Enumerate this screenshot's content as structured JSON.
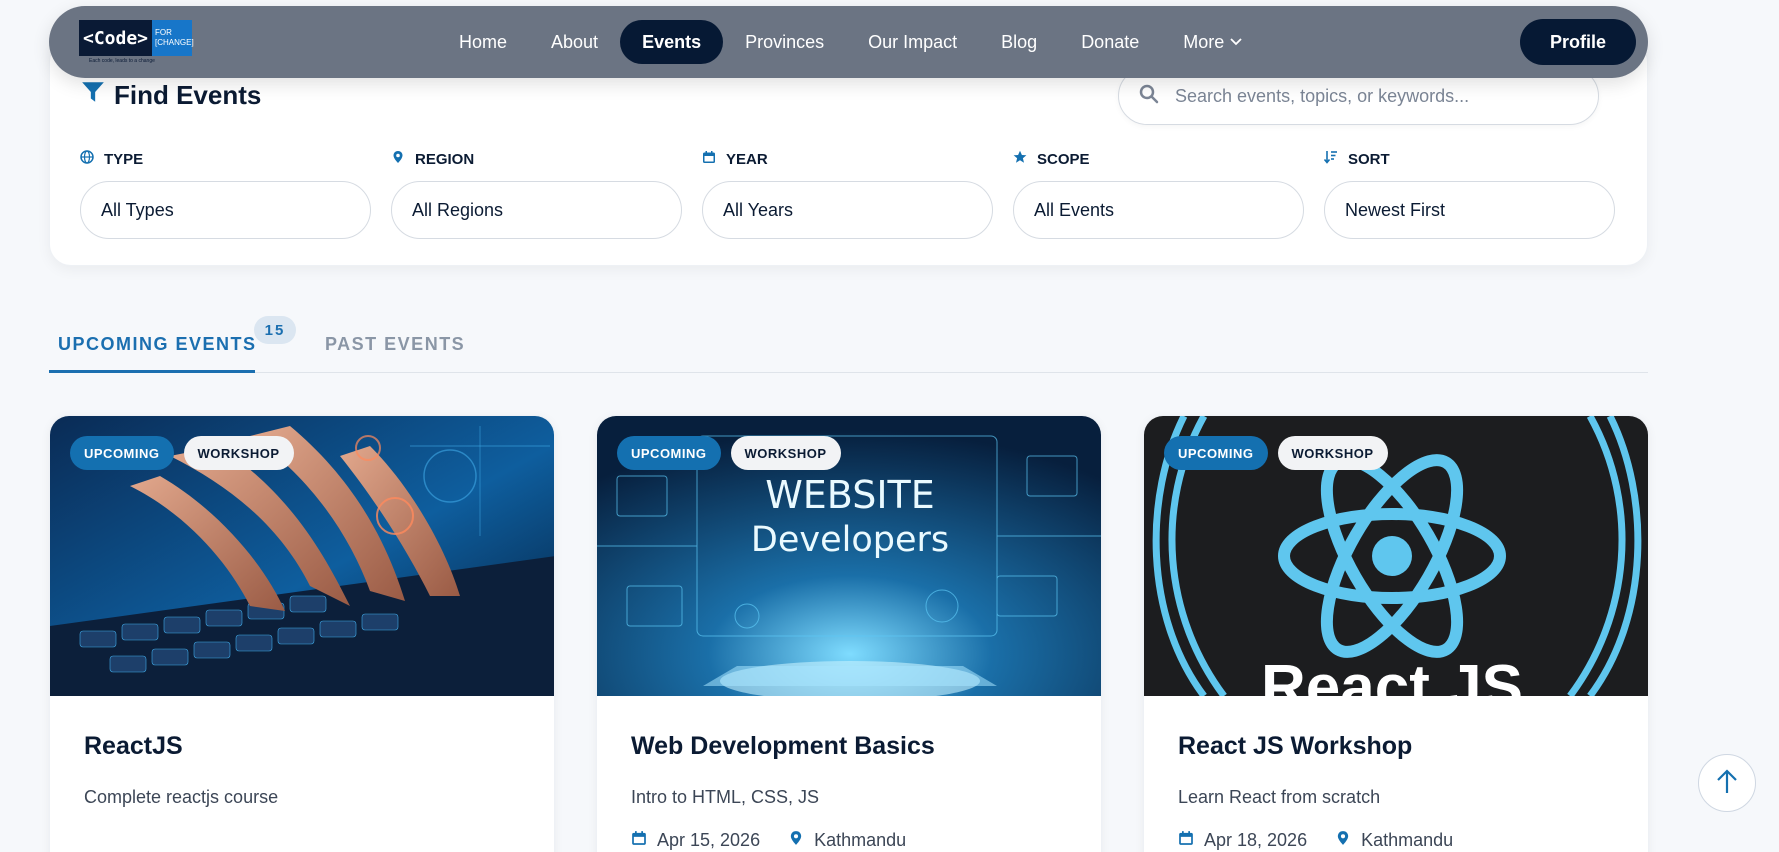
{
  "nav": {
    "logo": {
      "code": "<Code>",
      "for": "FOR",
      "change": "[CHANGE]",
      "tagline": "Each code, leads to a change"
    },
    "links": [
      {
        "label": "Home"
      },
      {
        "label": "About"
      },
      {
        "label": "Events",
        "active": true
      },
      {
        "label": "Provinces"
      },
      {
        "label": "Our Impact"
      },
      {
        "label": "Blog"
      },
      {
        "label": "Donate"
      },
      {
        "label": "More"
      }
    ],
    "profile_label": "Profile"
  },
  "filters": {
    "title": "Find Events",
    "search_placeholder": "Search events, topics, or keywords...",
    "items": [
      {
        "label": "TYPE",
        "value": "All Types",
        "icon": "globe-icon"
      },
      {
        "label": "REGION",
        "value": "All Regions",
        "icon": "map-pin-icon"
      },
      {
        "label": "YEAR",
        "value": "All Years",
        "icon": "calendar-icon"
      },
      {
        "label": "SCOPE",
        "value": "All Events",
        "icon": "star-icon"
      },
      {
        "label": "SORT",
        "value": "Newest First",
        "icon": "sort-icon"
      }
    ]
  },
  "tabs": {
    "upcoming": "UPCOMING EVENTS",
    "count": "15",
    "past": "PAST EVENTS"
  },
  "events": [
    {
      "status": "UPCOMING",
      "type": "WORKSHOP",
      "title": "ReactJS",
      "description": "Complete reactjs course",
      "date": "",
      "location": ""
    },
    {
      "status": "UPCOMING",
      "type": "WORKSHOP",
      "title": "Web Development Basics",
      "description": "Intro to HTML, CSS, JS",
      "date": "Apr 15, 2026",
      "location": "Kathmandu",
      "image_text": [
        "WEBSITE",
        "Developers"
      ]
    },
    {
      "status": "UPCOMING",
      "type": "WORKSHOP",
      "title": "React JS Workshop",
      "description": "Learn React from scratch",
      "date": "Apr 18, 2026",
      "location": "Kathmandu",
      "image_text": [
        "React JS"
      ]
    }
  ],
  "colors": {
    "accent": "#1470b0",
    "navy": "#061934",
    "nav_bg": "#6b7483"
  }
}
